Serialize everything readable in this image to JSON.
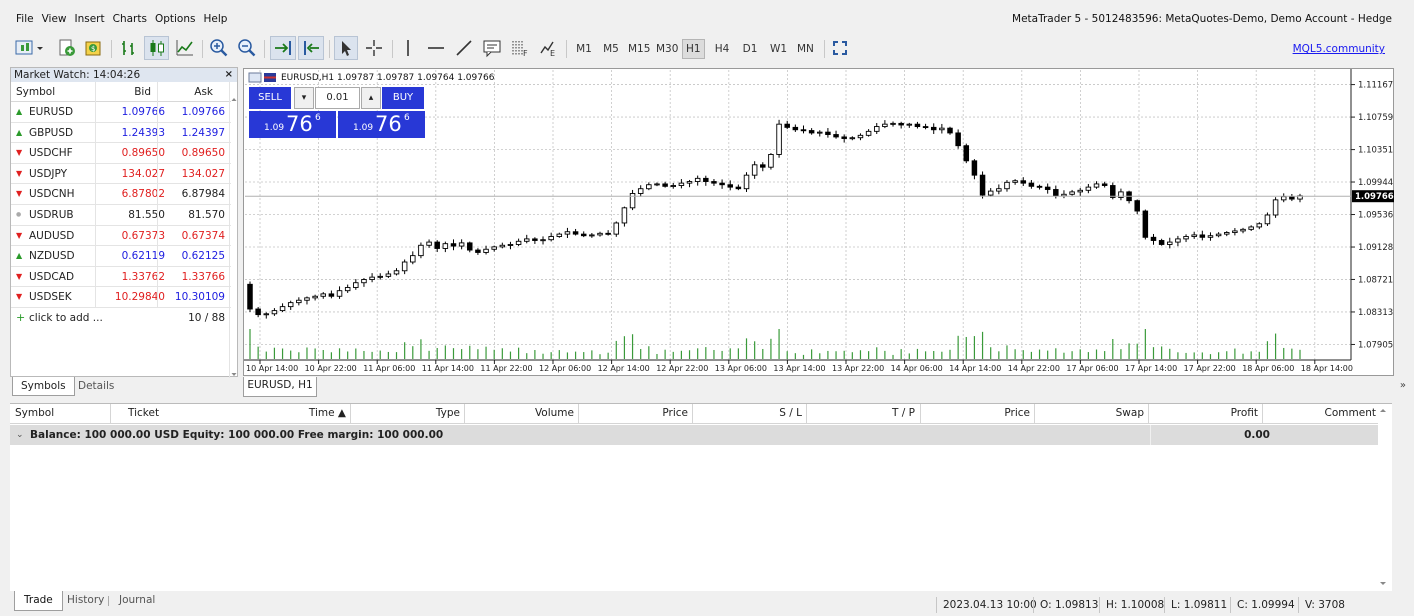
{
  "menu": [
    "File",
    "View",
    "Insert",
    "Charts",
    "Options",
    "Help"
  ],
  "window_title": "MetaTrader 5 - 5012483596: MetaQuotes-Demo, Demo Account - Hedge",
  "toolbar": {
    "timeframes": [
      "M1",
      "M5",
      "M15",
      "M30",
      "H1",
      "H4",
      "D1",
      "W1",
      "MN"
    ],
    "active_timeframe": "H1",
    "mql5_link": "MQL5.community"
  },
  "market_watch": {
    "title": "Market Watch: 14:04:26",
    "close": "×",
    "columns": {
      "symbol": "Symbol",
      "bid": "Bid",
      "ask": "Ask"
    },
    "rows": [
      {
        "symbol": "EURUSD",
        "bid": "1.09766",
        "ask": "1.09766",
        "dir": "up",
        "bid_color": "#2020e0",
        "ask_color": "#2020e0"
      },
      {
        "symbol": "GBPUSD",
        "bid": "1.24393",
        "ask": "1.24397",
        "dir": "up",
        "bid_color": "#2020e0",
        "ask_color": "#2020e0"
      },
      {
        "symbol": "USDCHF",
        "bid": "0.89650",
        "ask": "0.89650",
        "dir": "down",
        "bid_color": "#e02020",
        "ask_color": "#e02020"
      },
      {
        "symbol": "USDJPY",
        "bid": "134.027",
        "ask": "134.027",
        "dir": "down",
        "bid_color": "#e02020",
        "ask_color": "#e02020"
      },
      {
        "symbol": "USDCNH",
        "bid": "6.87802",
        "ask": "6.87984",
        "dir": "down",
        "bid_color": "#e02020",
        "ask_color": "#222222"
      },
      {
        "symbol": "USDRUB",
        "bid": "81.550",
        "ask": "81.570",
        "dir": "none",
        "bid_color": "#222222",
        "ask_color": "#222222"
      },
      {
        "symbol": "AUDUSD",
        "bid": "0.67373",
        "ask": "0.67374",
        "dir": "down",
        "bid_color": "#e02020",
        "ask_color": "#e02020"
      },
      {
        "symbol": "NZDUSD",
        "bid": "0.62119",
        "ask": "0.62125",
        "dir": "up",
        "bid_color": "#2020e0",
        "ask_color": "#2020e0"
      },
      {
        "symbol": "USDCAD",
        "bid": "1.33762",
        "ask": "1.33766",
        "dir": "down",
        "bid_color": "#e02020",
        "ask_color": "#e02020"
      },
      {
        "symbol": "USDSEK",
        "bid": "10.29840",
        "ask": "10.30109",
        "dir": "down",
        "bid_color": "#e02020",
        "ask_color": "#2020e0"
      }
    ],
    "add_label": "click to add ...",
    "count": "10 / 88",
    "tabs": [
      "Symbols",
      "Details"
    ]
  },
  "chart": {
    "info": "EURUSD,H1  1.09787 1.09787 1.09764 1.09766",
    "tab": "EURUSD, H1",
    "trade_panel": {
      "sell": "SELL",
      "buy": "BUY",
      "lot": "0.01",
      "sell_price_small": "1.09",
      "sell_price_big": "76",
      "sell_price_sup": "6",
      "buy_price_small": "1.09",
      "buy_price_big": "76",
      "buy_price_sup": "6"
    },
    "current_price": "1.09766"
  },
  "chart_data": {
    "type": "candlestick",
    "symbol": "EURUSD",
    "timeframe": "H1",
    "y_ticks": [
      "1.11167",
      "1.10759",
      "1.10351",
      "1.09944",
      "1.09536",
      "1.09128",
      "1.08721",
      "1.08313",
      "1.07905"
    ],
    "y_tick_values": [
      1.11167,
      1.10759,
      1.10351,
      1.09944,
      1.09536,
      1.09128,
      1.08721,
      1.08313,
      1.07905
    ],
    "x_ticks": [
      "10 Apr 14:00",
      "10 Apr 22:00",
      "11 Apr 06:00",
      "11 Apr 14:00",
      "11 Apr 22:00",
      "12 Apr 06:00",
      "12 Apr 14:00",
      "12 Apr 22:00",
      "13 Apr 06:00",
      "13 Apr 14:00",
      "13 Apr 22:00",
      "14 Apr 06:00",
      "14 Apr 14:00",
      "14 Apr 22:00",
      "17 Apr 06:00",
      "17 Apr 14:00",
      "17 Apr 22:00",
      "18 Apr 06:00",
      "18 Apr 14:00"
    ],
    "ylim": [
      1.0771,
      1.1135
    ],
    "close": [
      1.0835,
      1.0828,
      1.0829,
      1.0833,
      1.0838,
      1.0843,
      1.0846,
      1.0849,
      1.0851,
      1.0854,
      1.0851,
      1.0858,
      1.0862,
      1.0868,
      1.0872,
      1.0875,
      1.0876,
      1.0879,
      1.0883,
      1.0894,
      1.0902,
      1.0915,
      1.0919,
      1.0911,
      1.0917,
      1.0914,
      1.0918,
      1.0909,
      1.0906,
      1.091,
      1.0913,
      1.0915,
      1.0916,
      1.092,
      1.0923,
      1.0921,
      1.0922,
      1.0926,
      1.0929,
      1.0932,
      1.0929,
      1.0927,
      1.0928,
      1.093,
      1.0929,
      1.0943,
      1.0962,
      1.098,
      1.0986,
      1.0991,
      1.0992,
      1.0989,
      1.099,
      1.0993,
      1.0995,
      1.0999,
      1.0995,
      1.0993,
      1.0991,
      1.0988,
      1.0986,
      1.1003,
      1.1016,
      1.1013,
      1.1029,
      1.1067,
      1.1063,
      1.106,
      1.1059,
      1.1056,
      1.1057,
      1.1054,
      1.1051,
      1.1049,
      1.105,
      1.1053,
      1.1058,
      1.1064,
      1.1067,
      1.1068,
      1.1066,
      1.1067,
      1.1064,
      1.1063,
      1.106,
      1.1062,
      1.1056,
      1.104,
      1.1021,
      1.1003,
      1.0978,
      1.0983,
      1.0986,
      1.0994,
      1.0996,
      1.0993,
      1.0989,
      1.0988,
      1.0985,
      1.0977,
      1.0979,
      1.0982,
      1.0984,
      1.0988,
      1.0992,
      1.099,
      1.0975,
      1.0982,
      1.0971,
      1.0958,
      1.0925,
      1.0921,
      1.0916,
      1.0919,
      1.0923,
      1.0926,
      1.0928,
      1.0925,
      1.0927,
      1.0929,
      1.0931,
      1.0933,
      1.0935,
      1.0938,
      1.0942,
      1.0953,
      1.0972,
      1.0976,
      1.0973,
      1.0977
    ]
  },
  "toolbox": {
    "columns": [
      "Symbol",
      "Ticket",
      "Time ▲",
      "Type",
      "Volume",
      "Price",
      "S / L",
      "T / P",
      "Price",
      "Swap",
      "Profit",
      "Comment"
    ],
    "balance_text": "Balance: 100 000.00 USD  Equity: 100 000.00  Free margin: 100 000.00",
    "profit": "0.00",
    "tabs": [
      "Trade",
      "History",
      "Journal"
    ]
  },
  "statusbar": {
    "time": "2023.04.13 10:00",
    "open": "O: 1.09813",
    "high": "H: 1.10008",
    "low": "L: 1.09811",
    "close": "C: 1.09994",
    "volume": "V: 3708"
  },
  "colors": {
    "buy_sell_blue": "#2838d6",
    "volume_green": "#3a9a3a",
    "up_arrow": "#2a9a2a",
    "down_arrow": "#e02020"
  }
}
